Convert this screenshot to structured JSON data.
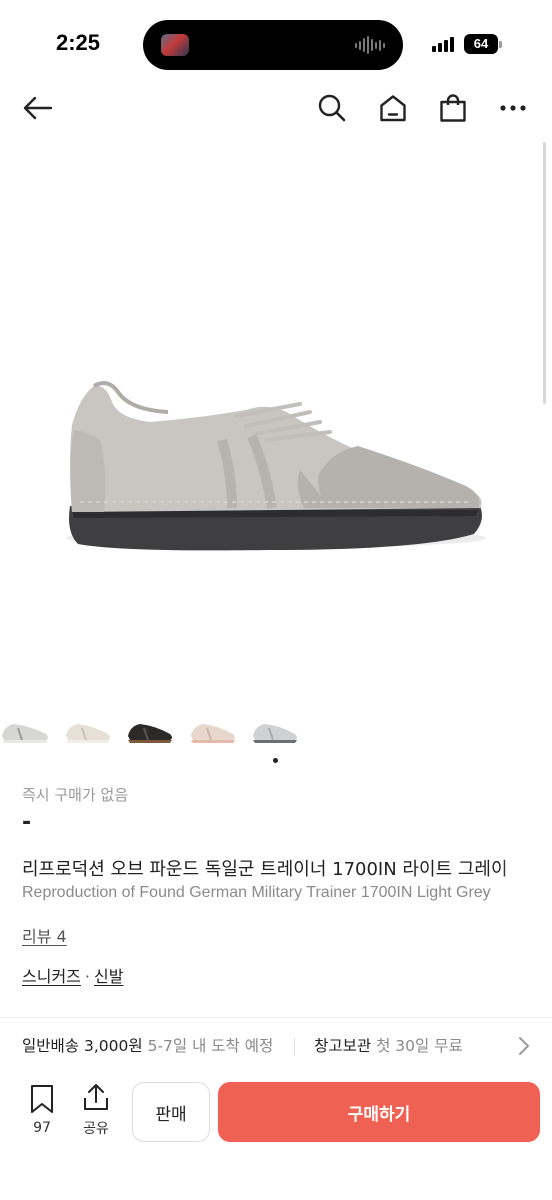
{
  "status_bar": {
    "time": "2:25",
    "battery": "64"
  },
  "nav": {
    "icons": [
      "back-arrow-icon",
      "search-icon",
      "home-icon",
      "shopping-bag-icon",
      "more-icon"
    ]
  },
  "product": {
    "image": "gray-german-military-trainer-sneaker",
    "thumbnails": [
      "gray-white",
      "beige-white",
      "black-gum",
      "beige-pink",
      "gray-light"
    ],
    "immediate_purchase": "즉시 구매가 없음",
    "price": "-",
    "title_ko": "리프로덕션 오브 파운드 독일군 트레이너 1700IN 라이트 그레이",
    "title_en": "Reproduction of Found German Military Trainer 1700IN Light Grey",
    "review": "리뷰 4",
    "category": "스니커즈",
    "category_sep": "·",
    "subcategory": "신발"
  },
  "shipping": {
    "type": "일반배송",
    "fee": "3,000원",
    "eta": "5-7일 내 도착 예정",
    "storage": "창고보관",
    "storage_note": "첫 30일 무료"
  },
  "bottom_bar": {
    "bookmark_count": "97",
    "share_label": "공유",
    "sell_label": "판매",
    "buy_label": "구매하기"
  },
  "colors": {
    "buy_button": "#ef6253",
    "text_primary": "#222222",
    "text_muted": "#8a8a8a"
  }
}
